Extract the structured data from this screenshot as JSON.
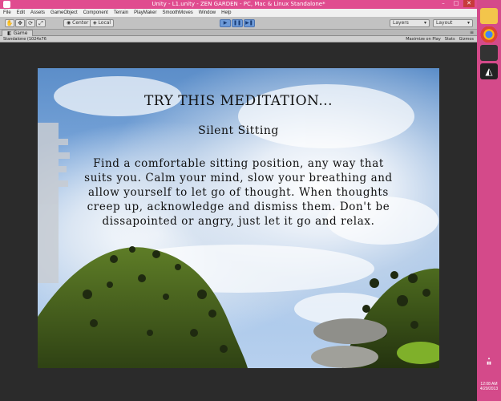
{
  "window": {
    "title": "Unity - L1.unity - ZEN GARDEN - PC, Mac & Linux Standalone*"
  },
  "menu": [
    "File",
    "Edit",
    "Assets",
    "GameObject",
    "Component",
    "Terrain",
    "PlayMaker",
    "SmoothMoves",
    "Window",
    "Help"
  ],
  "toolbar": {
    "pivot_label": "Center",
    "space_label": "Local",
    "play": {
      "play_icon": "play-icon",
      "pause_icon": "pause-icon",
      "step_icon": "step-icon"
    },
    "layers_label": "Layers",
    "layout_label": "Layout"
  },
  "game_panel": {
    "tab_label": "Game",
    "aspect_label": "Standalone (1024x76",
    "maximize_label": "Maximize on Play",
    "stats_label": "Stats",
    "gizmos_label": "Gizmos"
  },
  "overlay": {
    "heading": "TRY THIS MEDITATION...",
    "subtitle": "Silent Sitting",
    "body": "Find a comfortable sitting position, any way that suits you. Calm your mind, slow your breathing and allow yourself to let go of thought. When thoughts creep up, acknowledge and dismiss them. Don't be dissapointed or angry, just let it go and relax."
  },
  "taskbar": {
    "icons": [
      "file-explorer-icon",
      "chrome-icon",
      "inkscape-icon",
      "unity-icon"
    ],
    "time": "12:08 AM",
    "date": "4/29/2013"
  },
  "colors": {
    "titlebar": "#e04c8f",
    "taskbar": "#d44a8a",
    "grass": "#4e6a1f",
    "sky": "#7ea9dc"
  }
}
